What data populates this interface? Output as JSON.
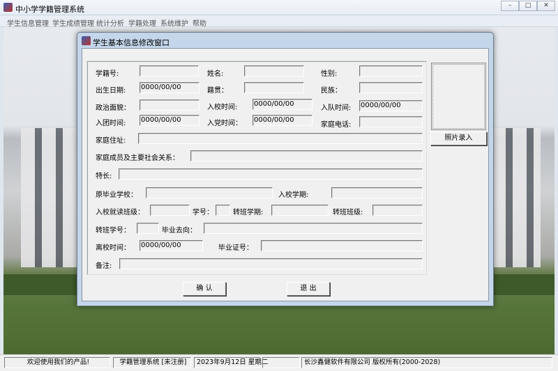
{
  "app": {
    "title": "中小学学籍管理系统",
    "minimize": "–",
    "maximize": "□",
    "close": "✕"
  },
  "menu": [
    "学生信息管理",
    "学生成绩管理",
    "统计分析",
    "学籍处理",
    "系统维护",
    "帮助"
  ],
  "dialog": {
    "title": "学生基本信息修改窗口"
  },
  "fields": {
    "student_id": {
      "label": "学籍号:",
      "value": ""
    },
    "name": {
      "label": "姓名:",
      "value": ""
    },
    "gender": {
      "label": "性别:",
      "value": ""
    },
    "birth_date": {
      "label": "出生日期:",
      "value": "0000/00/00"
    },
    "native_place": {
      "label": "籍贯：",
      "value": ""
    },
    "ethnicity": {
      "label": "民族：",
      "value": ""
    },
    "political_status": {
      "label": "政治面貌：",
      "value": ""
    },
    "enroll_date": {
      "label": "入校时间:",
      "value": "0000/00/00"
    },
    "pioneer_date": {
      "label": "入队时间:",
      "value": "0000/00/00"
    },
    "league_date": {
      "label": "入团时间:",
      "value": "0000/00/00"
    },
    "party_date": {
      "label": "入党时间：",
      "value": "0000/00/00"
    },
    "home_phone": {
      "label": "家庭电话:",
      "value": ""
    },
    "home_address": {
      "label": "家庭住址:",
      "value": ""
    },
    "family": {
      "label": "家庭成员及主要社会关系：",
      "value": ""
    },
    "specialty": {
      "label": "特长:",
      "value": ""
    },
    "prev_school": {
      "label": "原毕业学校：",
      "value": ""
    },
    "enroll_term": {
      "label": "入校学期:",
      "value": ""
    },
    "enroll_class": {
      "label": "入校就读班级：",
      "value": ""
    },
    "seat_no": {
      "label": "学号：",
      "value": ""
    },
    "transfer_term": {
      "label": "转班学期:",
      "value": ""
    },
    "transfer_class": {
      "label": "转班班级:",
      "value": ""
    },
    "transfer_no": {
      "label": "转班学号：",
      "value": ""
    },
    "destination": {
      "label": "毕业去向：",
      "value": ""
    },
    "leave_date": {
      "label": "离校时间：",
      "value": "0000/00/00"
    },
    "diploma_no": {
      "label": "毕业证号：",
      "value": ""
    },
    "remarks": {
      "label": "备注:",
      "value": ""
    }
  },
  "buttons": {
    "photo": "照片录入",
    "confirm": "确 认",
    "exit": "退 出"
  },
  "status": {
    "welcome": "欢迎使用我们的产品!",
    "product": "学籍管理系统 [未注册]",
    "date": "2023年9月12日  星期二",
    "blank": "",
    "company": "长沙鑫健软件有限公司   版权所有(2000-2028)"
  }
}
